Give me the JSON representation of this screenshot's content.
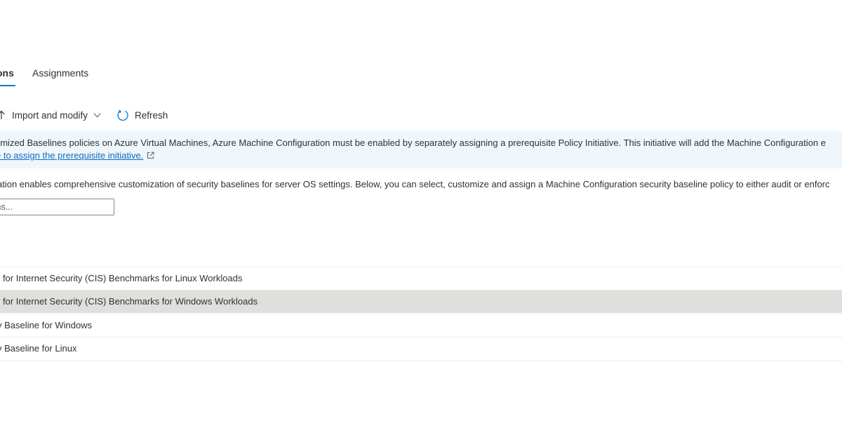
{
  "tabs": [
    {
      "label": "ons",
      "active": true
    },
    {
      "label": "Assignments",
      "active": false
    }
  ],
  "toolbar": {
    "import_label": "Import and modify",
    "refresh_label": "Refresh"
  },
  "info_banner": {
    "line1": "omized Baselines policies on Azure Virtual Machines, Azure Machine Configuration must be enabled by separately assigning a prerequisite Policy Initiative. This initiative will add the Machine Configuration e",
    "link_text": "e to assign the prerequisite initiative."
  },
  "description": "ation enables comprehensive customization of security baselines for server OS settings. Below, you can select, customize and assign a Machine Configuration security baseline policy to either audit or enforc",
  "filter": {
    "placeholder": "ms..."
  },
  "list": {
    "rows": [
      {
        "label": "r for Internet Security (CIS) Benchmarks for Linux Workloads",
        "selected": false
      },
      {
        "label": "r for Internet Security (CIS) Benchmarks for Windows Workloads",
        "selected": true
      },
      {
        "label": "y Baseline for Windows",
        "selected": false
      },
      {
        "label": "y Baseline for Linux",
        "selected": false
      }
    ]
  },
  "colors": {
    "accent": "#0078d4",
    "link": "#0f6cbd",
    "banner_bg": "#eff6fc",
    "selected_row_bg": "#e1dfdd"
  },
  "icons": {
    "import": "arrow-up-icon",
    "dropdown": "chevron-down-icon",
    "refresh": "refresh-icon",
    "external": "external-link-icon"
  }
}
